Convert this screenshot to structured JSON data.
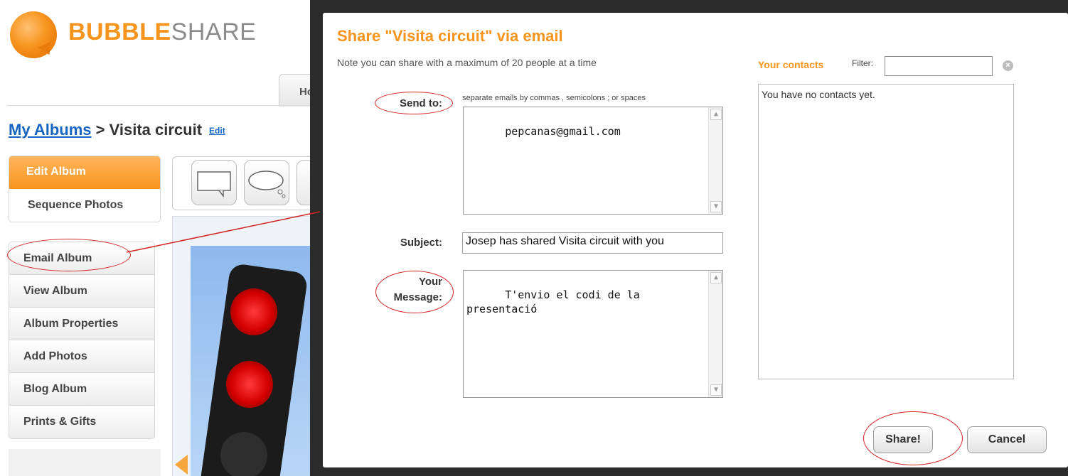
{
  "brand": {
    "part1": "BUBBLE",
    "part2": "SHARE"
  },
  "bg_tab": {
    "label": "Ho"
  },
  "breadcrumb": {
    "root": "My Albums",
    "separator": " > ",
    "album": "Visita circuit",
    "edit_label": "Edit"
  },
  "edit_panel": {
    "edit_album": "Edit Album",
    "sequence_photos": "Sequence Photos"
  },
  "menu": {
    "items": [
      {
        "label": "Email Album"
      },
      {
        "label": "View Album"
      },
      {
        "label": "Album Properties"
      },
      {
        "label": "Add Photos"
      },
      {
        "label": "Blog Album"
      },
      {
        "label": "Prints & Gifts"
      }
    ]
  },
  "modal": {
    "title": "Share \"Visita circuit\" via email",
    "note": "Note you can share with a maximum of 20 people at a time",
    "send_to_label": "Send to:",
    "send_to_hint": "separate emails by commas , semicolons ; or spaces",
    "send_to_value": "pepcanas@gmail.com",
    "subject_label": "Subject:",
    "subject_value": "Josep has shared Visita circuit with you",
    "message_label_1": "Your",
    "message_label_2": "Message:",
    "message_value": "T'envio el codi de la\npresentació",
    "contacts_title": "Your contacts",
    "filter_label": "Filter:",
    "filter_value": "",
    "contacts_empty": "You have no contacts yet.",
    "share_button": "Share!",
    "cancel_button": "Cancel"
  },
  "colors": {
    "brand_orange": "#f7941d",
    "link_blue": "#1565c0",
    "annotation_red": "#d22222",
    "overlay_dark": "#2b2b2b"
  },
  "icons": {
    "clear_filter": "close-circle-icon",
    "scroll_up": "scroll-up-icon",
    "scroll_down": "scroll-down-icon"
  }
}
